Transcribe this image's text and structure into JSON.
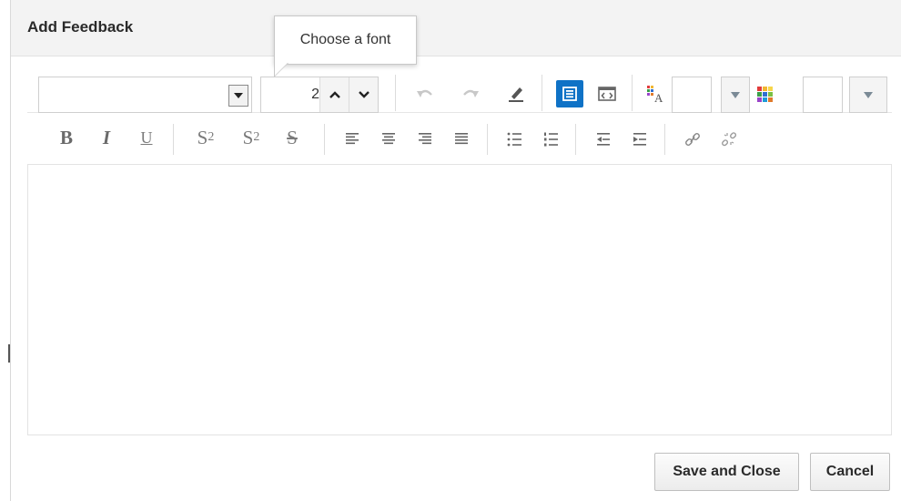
{
  "dialog": {
    "title": "Add Feedback",
    "tooltip": "Choose a font"
  },
  "toolbar": {
    "font_value": "",
    "font_size": "2",
    "icons_row1": [
      "undo-icon",
      "redo-icon",
      "clear-format-icon",
      "rich-text-mode-icon",
      "source-code-mode-icon",
      "text-color-icon",
      "background-color-icon"
    ],
    "format_labels": {
      "bold": "B",
      "italic": "I",
      "underline": "U",
      "subscript": "S",
      "subscript_sub": "2",
      "superscript": "S",
      "superscript_sup": "2",
      "strikethrough": "S"
    },
    "colors": {
      "active_mode": "#0f72c6",
      "text_color_field": "",
      "background_color_field": ""
    }
  },
  "editor": {
    "content": ""
  },
  "buttons": {
    "save_close": "Save and Close",
    "cancel": "Cancel"
  }
}
